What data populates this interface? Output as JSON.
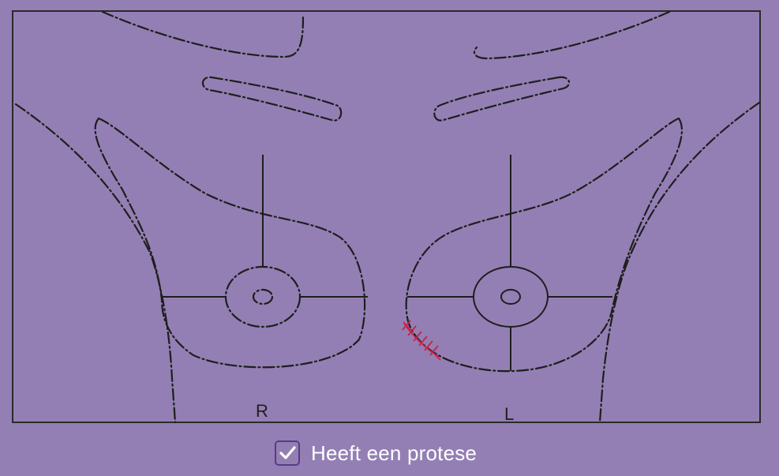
{
  "diagram": {
    "right_label": "R",
    "left_label": "L"
  },
  "prosthesis": {
    "checked": true,
    "label": "Heeft een protese"
  },
  "colors": {
    "background": "#937fb4",
    "line": "#1e1e1e",
    "scar_marking": "#c8234a",
    "checkbox_accent": "#5a3a86"
  }
}
